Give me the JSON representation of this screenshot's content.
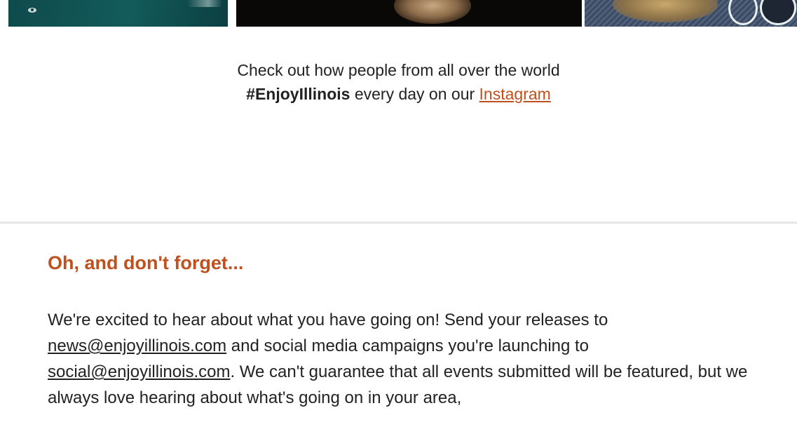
{
  "colors": {
    "accent": "#c0501e",
    "text": "#222222",
    "divider": "#e6e6e6",
    "background": "#ffffff"
  },
  "instagram": {
    "line1": "Check out how people from all over the world",
    "hashtag": "#EnjoyIllinois",
    "line2_middle": " every day on our ",
    "link_label": "Instagram"
  },
  "reminder": {
    "heading": "Oh, and don't forget...",
    "text_1": "We're excited to hear about what you have going on! Send your releases to ",
    "email_news": "news@enjoyillinois.com",
    "text_2": " and social media campaigns you're launching to ",
    "email_social": "social@enjoyillinois.com",
    "text_3": ". We can't guarantee that all events submitted will be featured, but we always love hearing about what's going on in your area,"
  }
}
